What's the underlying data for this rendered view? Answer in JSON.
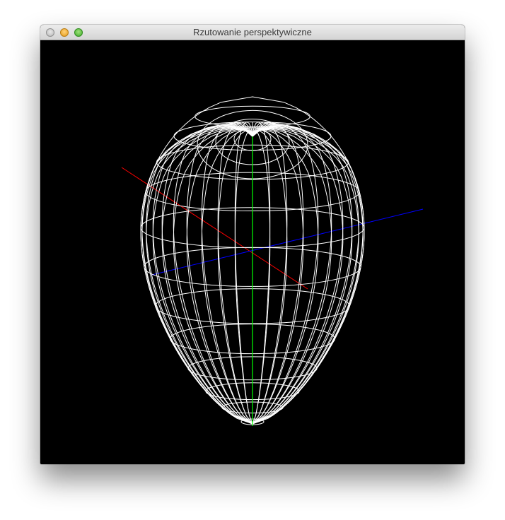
{
  "window": {
    "title": "Rzutowanie perspektywiczne",
    "controls": [
      "close",
      "minimize",
      "maximize"
    ]
  },
  "scene": {
    "background": "#000000",
    "wireframe_color": "#ffffff",
    "axes": {
      "x_color": "#ff0000",
      "y_color": "#00ff00",
      "z_color": "#0000ff"
    }
  }
}
